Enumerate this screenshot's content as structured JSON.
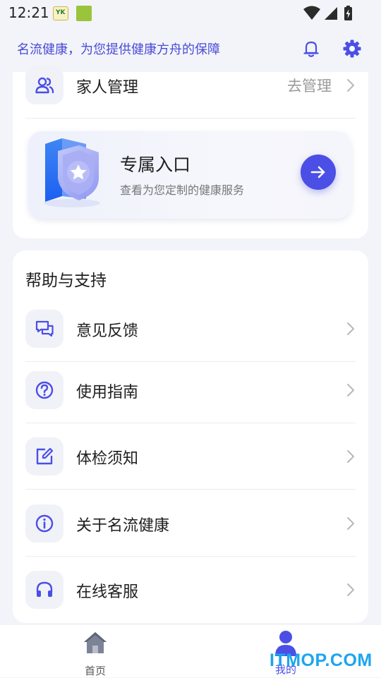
{
  "status_bar": {
    "time": "12:21",
    "app_badge_text": "YK",
    "icons": [
      "wifi-icon",
      "signal-icon",
      "battery-icon"
    ]
  },
  "header": {
    "slogan": "名流健康，为您提供健康方舟的保障",
    "icons": [
      "bell-icon",
      "gear-icon"
    ]
  },
  "family_row": {
    "label": "家人管理",
    "action": "去管理",
    "icon": "users-icon"
  },
  "banner": {
    "title": "专属入口",
    "subtitle": "查看为您定制的健康服务",
    "icon": "shield-star-icon"
  },
  "help": {
    "title": "帮助与支持",
    "items": [
      {
        "label": "意见反馈",
        "icon": "chat-icon"
      },
      {
        "label": "使用指南",
        "icon": "question-icon"
      },
      {
        "label": "体检须知",
        "icon": "edit-icon"
      },
      {
        "label": "关于名流健康",
        "icon": "info-icon"
      },
      {
        "label": "在线客服",
        "icon": "headset-icon"
      }
    ]
  },
  "bottom_nav": {
    "items": [
      {
        "label": "首页",
        "icon": "home-icon",
        "active": false
      },
      {
        "label": "我的",
        "icon": "person-icon",
        "active": true
      }
    ]
  },
  "watermark": "ITMOP.COM",
  "colors": {
    "accent": "#4b4fe6",
    "slogan": "#4a4cd6",
    "background": "#f3f4f9",
    "card": "#ffffff",
    "watermark": "#1aa6ee"
  }
}
